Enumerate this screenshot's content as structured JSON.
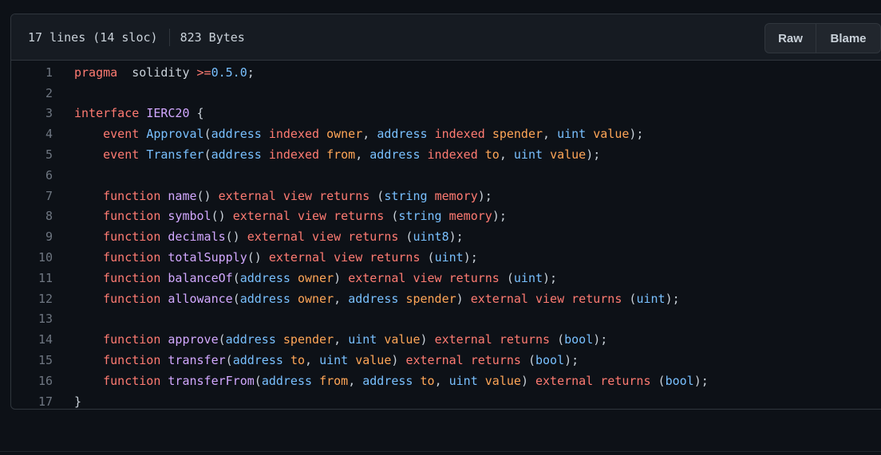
{
  "header": {
    "lines_info": "17 lines (14 sloc)",
    "size_info": "823 Bytes",
    "raw_label": "Raw",
    "blame_label": "Blame"
  },
  "colors": {
    "background": "#0d1117",
    "keyword": "#ff7b72",
    "type": "#79c0ff",
    "function": "#d2a8ff",
    "variable": "#ffa657",
    "text": "#c9d1d9"
  },
  "code_lines": [
    [
      [
        "k",
        "pragma"
      ],
      [
        "",
        "  solidity "
      ],
      [
        "k",
        ">="
      ],
      [
        "n",
        "0.5.0"
      ],
      [
        "",
        ";"
      ]
    ],
    [],
    [
      [
        "k",
        "interface"
      ],
      [
        "",
        " "
      ],
      [
        "f",
        "IERC20"
      ],
      [
        "",
        " {"
      ]
    ],
    [
      [
        "",
        ""
      ],
      [
        "k",
        "    event"
      ],
      [
        "",
        " "
      ],
      [
        "t",
        "Approval"
      ],
      [
        "",
        "("
      ],
      [
        "t",
        "address"
      ],
      [
        "",
        " "
      ],
      [
        "k",
        "indexed"
      ],
      [
        "",
        " "
      ],
      [
        "v",
        "owner"
      ],
      [
        "",
        ", "
      ],
      [
        "t",
        "address"
      ],
      [
        "",
        " "
      ],
      [
        "k",
        "indexed"
      ],
      [
        "",
        " "
      ],
      [
        "v",
        "spender"
      ],
      [
        "",
        ", "
      ],
      [
        "t",
        "uint"
      ],
      [
        "",
        " "
      ],
      [
        "v",
        "value"
      ],
      [
        "",
        ");"
      ]
    ],
    [
      [
        "k",
        "    event"
      ],
      [
        "",
        " "
      ],
      [
        "t",
        "Transfer"
      ],
      [
        "",
        "("
      ],
      [
        "t",
        "address"
      ],
      [
        "",
        " "
      ],
      [
        "k",
        "indexed"
      ],
      [
        "",
        " "
      ],
      [
        "v",
        "from"
      ],
      [
        "",
        ", "
      ],
      [
        "t",
        "address"
      ],
      [
        "",
        " "
      ],
      [
        "k",
        "indexed"
      ],
      [
        "",
        " "
      ],
      [
        "v",
        "to"
      ],
      [
        "",
        ", "
      ],
      [
        "t",
        "uint"
      ],
      [
        "",
        " "
      ],
      [
        "v",
        "value"
      ],
      [
        "",
        ");"
      ]
    ],
    [],
    [
      [
        "k",
        "    function"
      ],
      [
        "",
        " "
      ],
      [
        "f",
        "name"
      ],
      [
        "",
        "() "
      ],
      [
        "k",
        "external"
      ],
      [
        "",
        " "
      ],
      [
        "k",
        "view"
      ],
      [
        "",
        " "
      ],
      [
        "k",
        "returns"
      ],
      [
        "",
        " ("
      ],
      [
        "t",
        "string"
      ],
      [
        "",
        " "
      ],
      [
        "k",
        "memory"
      ],
      [
        "",
        ");"
      ]
    ],
    [
      [
        "k",
        "    function"
      ],
      [
        "",
        " "
      ],
      [
        "f",
        "symbol"
      ],
      [
        "",
        "() "
      ],
      [
        "k",
        "external"
      ],
      [
        "",
        " "
      ],
      [
        "k",
        "view"
      ],
      [
        "",
        " "
      ],
      [
        "k",
        "returns"
      ],
      [
        "",
        " ("
      ],
      [
        "t",
        "string"
      ],
      [
        "",
        " "
      ],
      [
        "k",
        "memory"
      ],
      [
        "",
        ");"
      ]
    ],
    [
      [
        "k",
        "    function"
      ],
      [
        "",
        " "
      ],
      [
        "f",
        "decimals"
      ],
      [
        "",
        "() "
      ],
      [
        "k",
        "external"
      ],
      [
        "",
        " "
      ],
      [
        "k",
        "view"
      ],
      [
        "",
        " "
      ],
      [
        "k",
        "returns"
      ],
      [
        "",
        " ("
      ],
      [
        "t",
        "uint8"
      ],
      [
        "",
        ");"
      ]
    ],
    [
      [
        "k",
        "    function"
      ],
      [
        "",
        " "
      ],
      [
        "f",
        "totalSupply"
      ],
      [
        "",
        "() "
      ],
      [
        "k",
        "external"
      ],
      [
        "",
        " "
      ],
      [
        "k",
        "view"
      ],
      [
        "",
        " "
      ],
      [
        "k",
        "returns"
      ],
      [
        "",
        " ("
      ],
      [
        "t",
        "uint"
      ],
      [
        "",
        ");"
      ]
    ],
    [
      [
        "k",
        "    function"
      ],
      [
        "",
        " "
      ],
      [
        "f",
        "balanceOf"
      ],
      [
        "",
        "("
      ],
      [
        "t",
        "address"
      ],
      [
        "",
        " "
      ],
      [
        "v",
        "owner"
      ],
      [
        "",
        ") "
      ],
      [
        "k",
        "external"
      ],
      [
        "",
        " "
      ],
      [
        "k",
        "view"
      ],
      [
        "",
        " "
      ],
      [
        "k",
        "returns"
      ],
      [
        "",
        " ("
      ],
      [
        "t",
        "uint"
      ],
      [
        "",
        ");"
      ]
    ],
    [
      [
        "k",
        "    function"
      ],
      [
        "",
        " "
      ],
      [
        "f",
        "allowance"
      ],
      [
        "",
        "("
      ],
      [
        "t",
        "address"
      ],
      [
        "",
        " "
      ],
      [
        "v",
        "owner"
      ],
      [
        "",
        ", "
      ],
      [
        "t",
        "address"
      ],
      [
        "",
        " "
      ],
      [
        "v",
        "spender"
      ],
      [
        "",
        ") "
      ],
      [
        "k",
        "external"
      ],
      [
        "",
        " "
      ],
      [
        "k",
        "view"
      ],
      [
        "",
        " "
      ],
      [
        "k",
        "returns"
      ],
      [
        "",
        " ("
      ],
      [
        "t",
        "uint"
      ],
      [
        "",
        ");"
      ]
    ],
    [],
    [
      [
        "k",
        "    function"
      ],
      [
        "",
        " "
      ],
      [
        "f",
        "approve"
      ],
      [
        "",
        "("
      ],
      [
        "t",
        "address"
      ],
      [
        "",
        " "
      ],
      [
        "v",
        "spender"
      ],
      [
        "",
        ", "
      ],
      [
        "t",
        "uint"
      ],
      [
        "",
        " "
      ],
      [
        "v",
        "value"
      ],
      [
        "",
        ") "
      ],
      [
        "k",
        "external"
      ],
      [
        "",
        " "
      ],
      [
        "k",
        "returns"
      ],
      [
        "",
        " ("
      ],
      [
        "t",
        "bool"
      ],
      [
        "",
        ");"
      ]
    ],
    [
      [
        "k",
        "    function"
      ],
      [
        "",
        " "
      ],
      [
        "f",
        "transfer"
      ],
      [
        "",
        "("
      ],
      [
        "t",
        "address"
      ],
      [
        "",
        " "
      ],
      [
        "v",
        "to"
      ],
      [
        "",
        ", "
      ],
      [
        "t",
        "uint"
      ],
      [
        "",
        " "
      ],
      [
        "v",
        "value"
      ],
      [
        "",
        ") "
      ],
      [
        "k",
        "external"
      ],
      [
        "",
        " "
      ],
      [
        "k",
        "returns"
      ],
      [
        "",
        " ("
      ],
      [
        "t",
        "bool"
      ],
      [
        "",
        ");"
      ]
    ],
    [
      [
        "k",
        "    function"
      ],
      [
        "",
        " "
      ],
      [
        "f",
        "transferFrom"
      ],
      [
        "",
        "("
      ],
      [
        "t",
        "address"
      ],
      [
        "",
        " "
      ],
      [
        "v",
        "from"
      ],
      [
        "",
        ", "
      ],
      [
        "t",
        "address"
      ],
      [
        "",
        " "
      ],
      [
        "v",
        "to"
      ],
      [
        "",
        ", "
      ],
      [
        "t",
        "uint"
      ],
      [
        "",
        " "
      ],
      [
        "v",
        "value"
      ],
      [
        "",
        ") "
      ],
      [
        "k",
        "external"
      ],
      [
        "",
        " "
      ],
      [
        "k",
        "returns"
      ],
      [
        "",
        " ("
      ],
      [
        "t",
        "bool"
      ],
      [
        "",
        ");"
      ]
    ],
    [
      [
        "",
        "}"
      ]
    ]
  ]
}
